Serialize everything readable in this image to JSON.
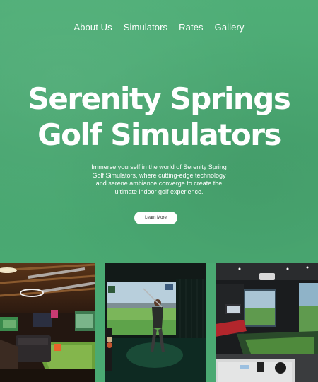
{
  "nav": {
    "items": [
      "About Us",
      "Simulators",
      "Rates",
      "Gallery"
    ]
  },
  "hero": {
    "title_line1": "Serenity Springs",
    "title_line2": "Golf Simulators",
    "description": "Immerse yourself in the world of Serenity Spring Golf Simulators, where cutting-edge technology and serene ambiance converge to create the ultimate indoor golf experience.",
    "cta_label": "Learn More"
  },
  "gallery": {
    "images": [
      "lounge-photo",
      "golfer-swing-photo",
      "simulator-bay-photo"
    ]
  },
  "colors": {
    "background": "#4aa972",
    "text": "#ffffff",
    "button": "#ffffff"
  }
}
